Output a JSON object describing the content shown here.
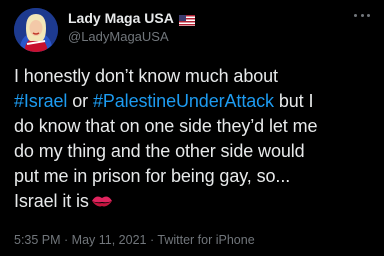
{
  "author": {
    "display_name": "Lady Maga USA",
    "handle": "@LadyMagaUSA",
    "avatar_icon": "avatar-person-icon",
    "flag_icon": "us-flag-icon"
  },
  "tweet": {
    "line1": "I honestly don’t know much about",
    "hashtag1": "#Israel",
    "or_text": " or ",
    "hashtag2": "#PalestineUnderAttack",
    "line2_rest": " but I",
    "line3": "do know that on one side they’d let me",
    "line4": "do my thing and the other side would",
    "line5": "put me in prison for being gay, so...",
    "line6": "Israel it is",
    "emoji_icon": "kiss-mark-icon"
  },
  "meta": {
    "time": "5:35 PM",
    "date": "May 11, 2021",
    "source": "Twitter for iPhone",
    "separator": " · "
  },
  "colors": {
    "background": "#000000",
    "text": "#e7e9ea",
    "secondary": "#71767b",
    "hashtag": "#1d9bf0"
  }
}
